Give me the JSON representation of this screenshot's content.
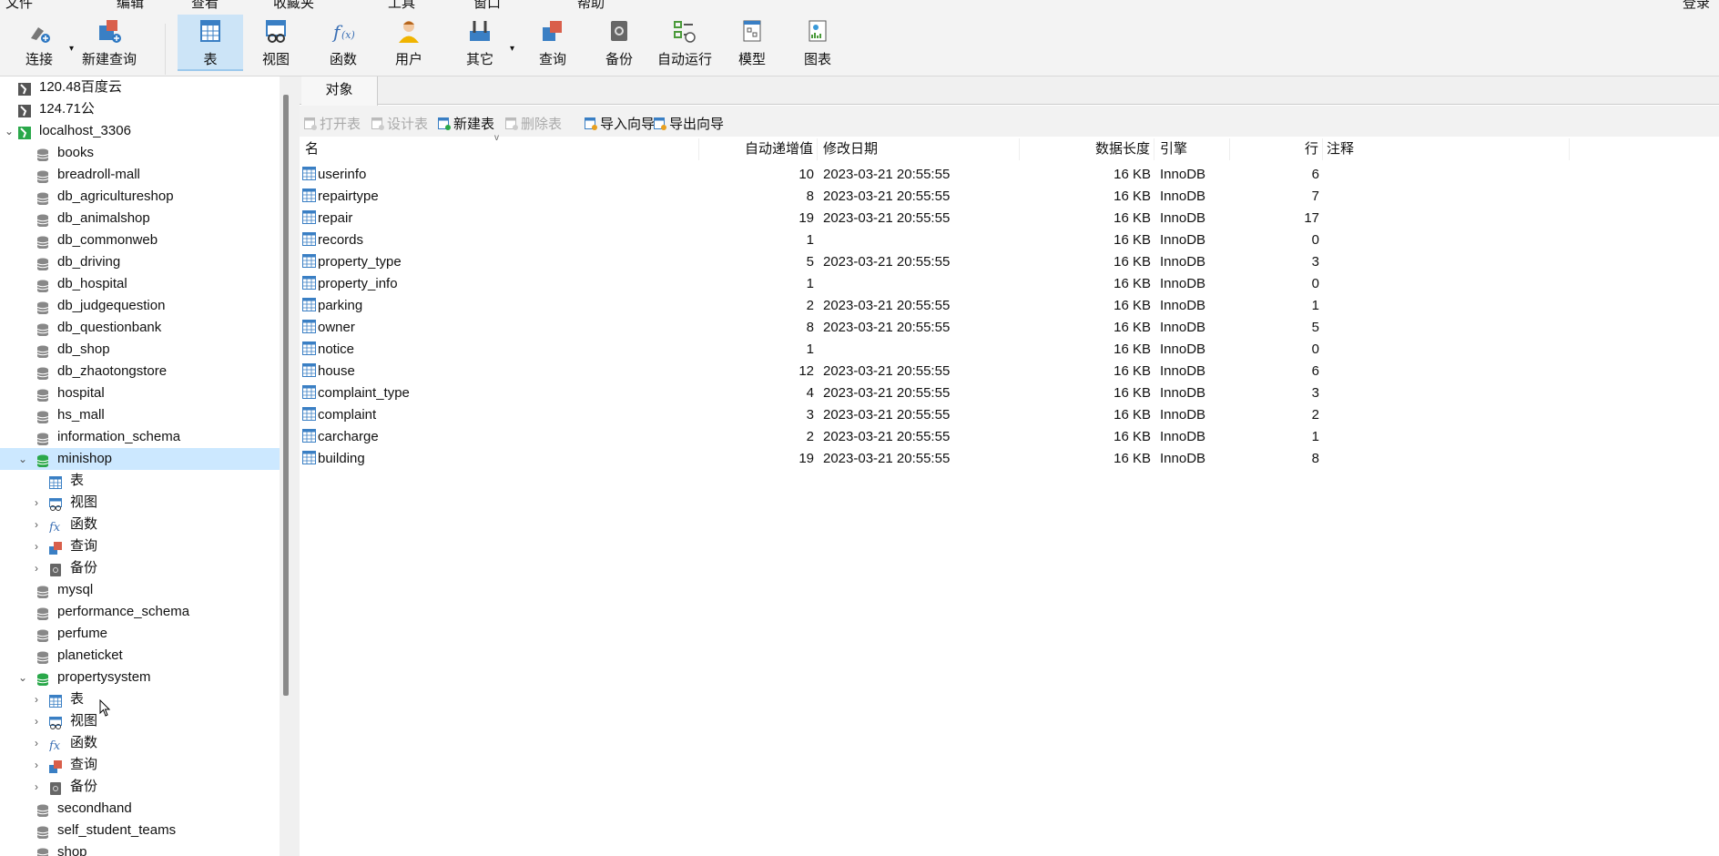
{
  "menu": [
    "文件",
    "编辑",
    "查看",
    "收藏夹",
    "工具",
    "窗口",
    "帮助"
  ],
  "login": "登录",
  "toolbar": [
    {
      "label": "连接",
      "icon": "connect-icon"
    },
    {
      "label": "新建查询",
      "icon": "new-query-icon"
    },
    {
      "label": "表",
      "icon": "table-icon"
    },
    {
      "label": "视图",
      "icon": "view-icon"
    },
    {
      "label": "函数",
      "icon": "function-icon"
    },
    {
      "label": "用户",
      "icon": "user-icon"
    },
    {
      "label": "其它",
      "icon": "tools-icon"
    },
    {
      "label": "查询",
      "icon": "query-icon"
    },
    {
      "label": "备份",
      "icon": "backup-icon"
    },
    {
      "label": "自动运行",
      "icon": "schedule-icon"
    },
    {
      "label": "模型",
      "icon": "model-icon"
    },
    {
      "label": "图表",
      "icon": "chart-icon"
    }
  ],
  "sidebar": [
    {
      "label": "120.48百度云",
      "level": 1,
      "type": "conn-off"
    },
    {
      "label": "124.71公",
      "level": 1,
      "type": "conn-off"
    },
    {
      "label": "localhost_3306",
      "level": 1,
      "type": "conn-on",
      "arrow": "open"
    },
    {
      "label": "books",
      "level": 2,
      "type": "db"
    },
    {
      "label": "breadroll-mall",
      "level": 2,
      "type": "db"
    },
    {
      "label": "db_agricultureshop",
      "level": 2,
      "type": "db"
    },
    {
      "label": "db_animalshop",
      "level": 2,
      "type": "db"
    },
    {
      "label": "db_commonweb",
      "level": 2,
      "type": "db"
    },
    {
      "label": "db_driving",
      "level": 2,
      "type": "db"
    },
    {
      "label": "db_hospital",
      "level": 2,
      "type": "db"
    },
    {
      "label": "db_judgequestion",
      "level": 2,
      "type": "db"
    },
    {
      "label": "db_questionbank",
      "level": 2,
      "type": "db"
    },
    {
      "label": "db_shop",
      "level": 2,
      "type": "db"
    },
    {
      "label": "db_zhaotongstore",
      "level": 2,
      "type": "db"
    },
    {
      "label": "hospital",
      "level": 2,
      "type": "db"
    },
    {
      "label": "hs_mall",
      "level": 2,
      "type": "db"
    },
    {
      "label": "information_schema",
      "level": 2,
      "type": "db"
    },
    {
      "label": "minishop",
      "level": 2,
      "type": "db-on",
      "arrow": "open",
      "selected": true
    },
    {
      "label": "表",
      "level": 3,
      "type": "table"
    },
    {
      "label": "视图",
      "level": 3,
      "type": "view",
      "arrow": "closed"
    },
    {
      "label": "函数",
      "level": 3,
      "type": "func",
      "arrow": "closed"
    },
    {
      "label": "查询",
      "level": 3,
      "type": "query",
      "arrow": "closed"
    },
    {
      "label": "备份",
      "level": 3,
      "type": "backup",
      "arrow": "closed"
    },
    {
      "label": "mysql",
      "level": 2,
      "type": "db"
    },
    {
      "label": "performance_schema",
      "level": 2,
      "type": "db"
    },
    {
      "label": "perfume",
      "level": 2,
      "type": "db"
    },
    {
      "label": "planeticket",
      "level": 2,
      "type": "db"
    },
    {
      "label": "propertysystem",
      "level": 2,
      "type": "db-on",
      "arrow": "open"
    },
    {
      "label": "表",
      "level": 3,
      "type": "table",
      "arrow": "closed"
    },
    {
      "label": "视图",
      "level": 3,
      "type": "view",
      "arrow": "closed"
    },
    {
      "label": "函数",
      "level": 3,
      "type": "func",
      "arrow": "closed"
    },
    {
      "label": "查询",
      "level": 3,
      "type": "query",
      "arrow": "closed"
    },
    {
      "label": "备份",
      "level": 3,
      "type": "backup",
      "arrow": "closed"
    },
    {
      "label": "secondhand",
      "level": 2,
      "type": "db"
    },
    {
      "label": "self_student_teams",
      "level": 2,
      "type": "db"
    },
    {
      "label": "shop",
      "level": 2,
      "type": "db"
    }
  ],
  "tab": "对象",
  "objbar": [
    {
      "label": "打开表",
      "disabled": true
    },
    {
      "label": "设计表",
      "disabled": true
    },
    {
      "label": "新建表",
      "disabled": false
    },
    {
      "label": "删除表",
      "disabled": true
    },
    {
      "label": "导入向导",
      "disabled": false
    },
    {
      "label": "导出向导",
      "disabled": false
    }
  ],
  "columns": [
    "名",
    "自动递增值",
    "修改日期",
    "数据长度",
    "引擎",
    "行",
    "注释"
  ],
  "rows": [
    [
      "userinfo",
      "10",
      "2023-03-21 20:55:55",
      "16 KB",
      "InnoDB",
      "6",
      ""
    ],
    [
      "repairtype",
      "8",
      "2023-03-21 20:55:55",
      "16 KB",
      "InnoDB",
      "7",
      ""
    ],
    [
      "repair",
      "19",
      "2023-03-21 20:55:55",
      "16 KB",
      "InnoDB",
      "17",
      ""
    ],
    [
      "records",
      "1",
      "",
      "16 KB",
      "InnoDB",
      "0",
      ""
    ],
    [
      "property_type",
      "5",
      "2023-03-21 20:55:55",
      "16 KB",
      "InnoDB",
      "3",
      ""
    ],
    [
      "property_info",
      "1",
      "",
      "16 KB",
      "InnoDB",
      "0",
      ""
    ],
    [
      "parking",
      "2",
      "2023-03-21 20:55:55",
      "16 KB",
      "InnoDB",
      "1",
      ""
    ],
    [
      "owner",
      "8",
      "2023-03-21 20:55:55",
      "16 KB",
      "InnoDB",
      "5",
      ""
    ],
    [
      "notice",
      "1",
      "",
      "16 KB",
      "InnoDB",
      "0",
      ""
    ],
    [
      "house",
      "12",
      "2023-03-21 20:55:55",
      "16 KB",
      "InnoDB",
      "6",
      ""
    ],
    [
      "complaint_type",
      "4",
      "2023-03-21 20:55:55",
      "16 KB",
      "InnoDB",
      "3",
      ""
    ],
    [
      "complaint",
      "3",
      "2023-03-21 20:55:55",
      "16 KB",
      "InnoDB",
      "2",
      ""
    ],
    [
      "carcharge",
      "2",
      "2023-03-21 20:55:55",
      "16 KB",
      "InnoDB",
      "1",
      ""
    ],
    [
      "building",
      "19",
      "2023-03-21 20:55:55",
      "16 KB",
      "InnoDB",
      "8",
      ""
    ]
  ]
}
